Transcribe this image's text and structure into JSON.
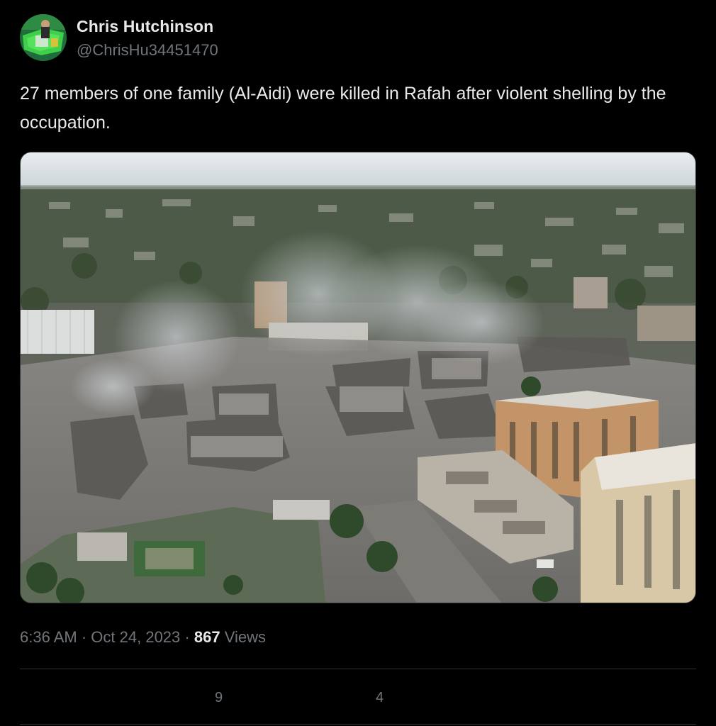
{
  "user": {
    "display_name": "Chris Hutchinson",
    "handle": "@ChrisHu34451470"
  },
  "tweet": {
    "text": "27 members of one family (Al-Aidi) were killed in Rafah after violent shelling by the occupation.",
    "time": "6:36 AM",
    "separator": "·",
    "date": "Oct 24, 2023",
    "views_count": "867",
    "views_label": "Views"
  },
  "actions": {
    "reposts_count": "9",
    "likes_count": "4"
  },
  "colors": {
    "background": "#000000",
    "text_primary": "#e7e9ea",
    "text_secondary": "#71767b",
    "divider": "#2f3336"
  }
}
